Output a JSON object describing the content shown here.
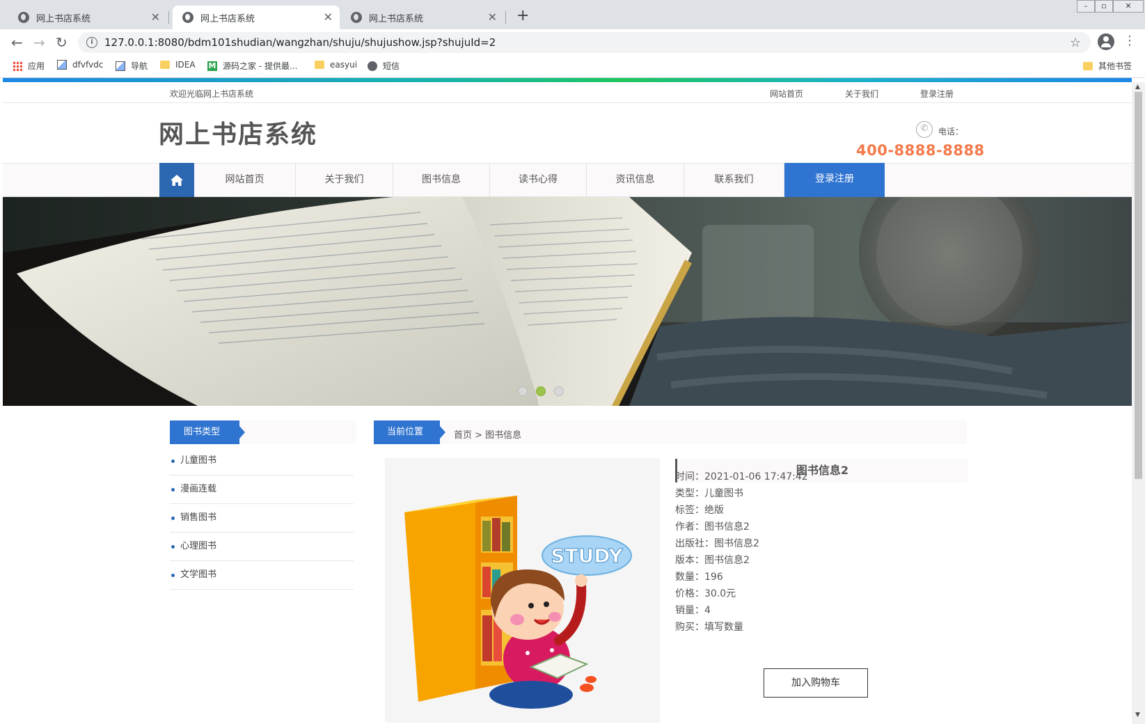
{
  "browser": {
    "tabs": [
      {
        "title": "网上书店系统",
        "close": "✕"
      },
      {
        "title": "网上书店系统",
        "close": "✕"
      },
      {
        "title": "网上书店系统",
        "close": "✕"
      }
    ],
    "new_tab": "+",
    "url": "127.0.0.1:8080/bdm101shudian/wangzhan/shuju/shujushow.jsp?shujuId=2",
    "bookmarks": [
      {
        "label": "应用",
        "icon": "apps-icon"
      },
      {
        "label": "dfvfvdc",
        "icon": "image-icon"
      },
      {
        "label": "导航",
        "icon": "image-icon"
      },
      {
        "label": "IDEA",
        "icon": "folder-icon"
      },
      {
        "label": "源码之家 - 提供最...",
        "icon": "m-logo-icon"
      },
      {
        "label": "easyui",
        "icon": "folder-icon"
      },
      {
        "label": "短信",
        "icon": "globe-icon"
      }
    ],
    "other_bookmarks": "其他书签"
  },
  "site": {
    "welcome": "欢迎光临网上书店系统",
    "top_links": [
      "网站首页",
      "关于我们",
      "登录注册"
    ],
    "logo": "网上书店系统",
    "phone_label": "电话：",
    "phone_number": "400-8888-8888",
    "nav": [
      "网站首页",
      "关于我们",
      "图书信息",
      "读书心得",
      "资讯信息",
      "联系我们",
      "登录注册"
    ],
    "nav_active_index": 6,
    "banner_active_dot": 2
  },
  "sidebar": {
    "title": "图书类型",
    "items": [
      "儿童图书",
      "漫画连载",
      "销售图书",
      "心理图书",
      "文学图书"
    ]
  },
  "breadcrumb": {
    "title": "当前位置",
    "path": "首页 > 图书信息"
  },
  "book": {
    "title": "图书信息2",
    "image_caption": "STUDY",
    "rows": [
      "时间：2021-01-06 17:47:42",
      "类型：儿童图书",
      "标签：绝版",
      "作者：图书信息2",
      "出版社：图书信息2",
      "版本：图书信息2",
      "数量：196",
      "价格：30.0元",
      "销量：4",
      "购买：填写数量"
    ],
    "add_to_cart": "加入购物车"
  },
  "colors": {
    "primary": "#2f74d0",
    "phone": "#f57a4a",
    "dot_active": "#9bc44a"
  }
}
